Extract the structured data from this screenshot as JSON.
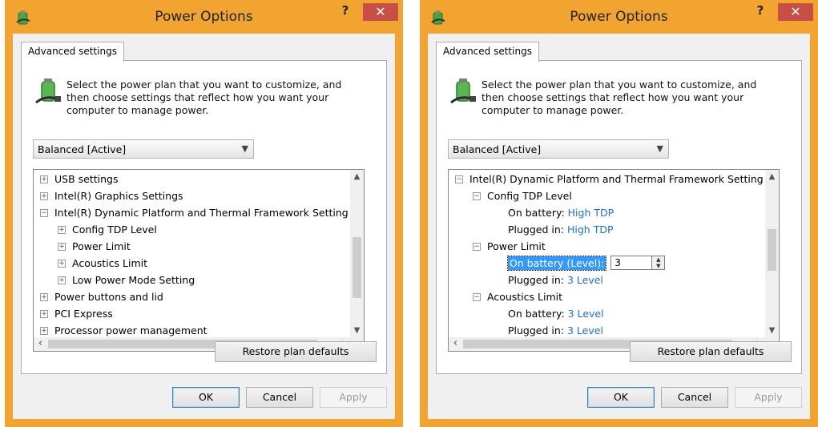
{
  "colors": {
    "frame": "#f2a431",
    "close": "#c74f45",
    "link": "#1d6fcf",
    "highlight": "#3399ff"
  },
  "windows": [
    {
      "title": "Power Options",
      "help_label": "?",
      "close_label": "✕",
      "tab_label": "Advanced settings",
      "description": "Select the power plan that you want to customize, and then choose settings that reflect how you want your computer to manage power.",
      "plan_select": {
        "value": "Balanced [Active]"
      },
      "tree": [
        {
          "label": "USB settings",
          "symbol": "+"
        },
        {
          "label": "Intel(R) Graphics Settings",
          "symbol": "+"
        },
        {
          "label": "Intel(R) Dynamic Platform and Thermal Framework Setting",
          "symbol": "−"
        },
        {
          "label": "Config TDP Level",
          "symbol": "+"
        },
        {
          "label": "Power Limit",
          "symbol": "+"
        },
        {
          "label": "Acoustics Limit",
          "symbol": "+"
        },
        {
          "label": "Low Power Mode Setting",
          "symbol": "+"
        },
        {
          "label": "Power buttons and lid",
          "symbol": "+"
        },
        {
          "label": "PCI Express",
          "symbol": "+"
        },
        {
          "label": "Processor power management",
          "symbol": "+"
        }
      ],
      "restore_label": "Restore plan defaults",
      "ok_label": "OK",
      "cancel_label": "Cancel",
      "apply_label": "Apply"
    },
    {
      "title": "Power Options",
      "help_label": "?",
      "close_label": "✕",
      "tab_label": "Advanced settings",
      "description": "Select the power plan that you want to customize, and then choose settings that reflect how you want your computer to manage power.",
      "plan_select": {
        "value": "Balanced [Active]"
      },
      "tree": [
        {
          "label": "Intel(R) Dynamic Platform and Thermal Framework Setting",
          "symbol": "−"
        },
        {
          "label": "Config TDP Level",
          "symbol": "−"
        },
        {
          "label": "On battery:",
          "value": "High TDP"
        },
        {
          "label": "Plugged in:",
          "value": "High TDP"
        },
        {
          "label": "Power Limit",
          "symbol": "−"
        },
        {
          "label": "On battery (Level):",
          "input_value": "3"
        },
        {
          "label": "Plugged in:",
          "value": "3 Level"
        },
        {
          "label": "Acoustics Limit",
          "symbol": "−"
        },
        {
          "label": "On battery:",
          "value": "3 Level"
        },
        {
          "label": "Plugged in:",
          "value": "3 Level"
        }
      ],
      "restore_label": "Restore plan defaults",
      "ok_label": "OK",
      "cancel_label": "Cancel",
      "apply_label": "Apply"
    }
  ]
}
